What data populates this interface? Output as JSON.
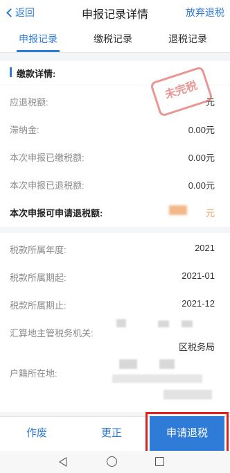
{
  "nav": {
    "back_label": "返回",
    "title": "申报记录详情",
    "abandon_label": "放弃退税"
  },
  "tabs": [
    {
      "label": "申报记录",
      "active": true
    },
    {
      "label": "缴税记录",
      "active": false
    },
    {
      "label": "退税记录",
      "active": false
    }
  ],
  "section": {
    "title": "缴款详情:"
  },
  "stamp": {
    "text": "未完税"
  },
  "details": [
    {
      "label": "应退税额:",
      "value": "元"
    },
    {
      "label": "滞纳金:",
      "value": "0.00元"
    },
    {
      "label": "本次申报已缴税额:",
      "value": "0.00元"
    },
    {
      "label": "本次申报已退税额:",
      "value": "0.00元"
    },
    {
      "label": "本次申报可申请退税额:",
      "value": "元"
    }
  ],
  "info": [
    {
      "label": "税款所属年度:",
      "value": "2021"
    },
    {
      "label": "税款所属期起:",
      "value": "2021-01"
    },
    {
      "label": "税款所属期止:",
      "value": "2021-12"
    },
    {
      "label": "汇算地主管税务机关:",
      "value": "区税务局"
    },
    {
      "label": "户籍所在地:",
      "value": ""
    }
  ],
  "bottom": {
    "void_label": "作废",
    "correct_label": "更正",
    "apply_label": "申请退税"
  },
  "colors": {
    "accent": "#2f7bd8",
    "highlight_box": "#e0201b",
    "stamp": "#d9534f"
  }
}
